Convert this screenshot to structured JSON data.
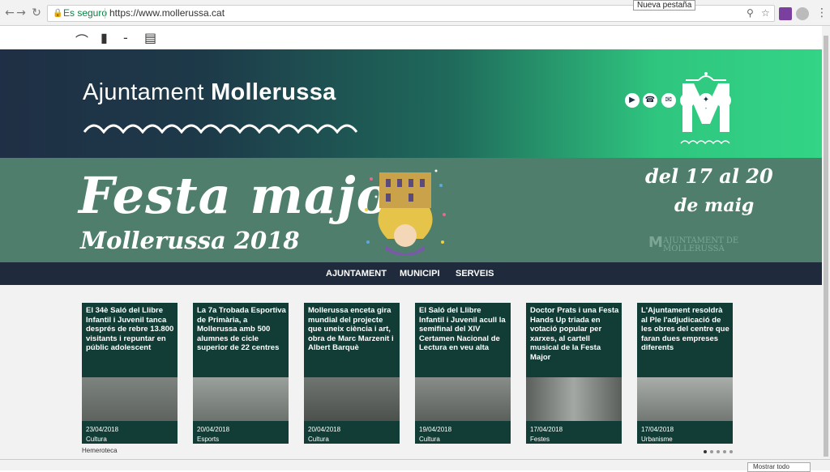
{
  "browser": {
    "secure_label": "Es seguro",
    "url": "https://www.mollerussa.cat",
    "tooltip": "Nueva pestaña",
    "icons": [
      "back-icon",
      "forward-icon",
      "reload-icon",
      "lock-icon",
      "search-icon",
      "star-icon",
      "menu-icon"
    ]
  },
  "accessibility": {
    "icons": [
      "contrast-icon",
      "text-size-icon",
      "minus-icon",
      "font-icon"
    ]
  },
  "header": {
    "title_light": "Ajuntament ",
    "title_bold": "Mollerussa",
    "logo_letter": "M",
    "social_icons": [
      "youtube-icon",
      "phone-icon",
      "email-icon",
      "facebook-icon",
      "twitter-icon",
      "instagram-icon"
    ],
    "colors": {
      "dark": "#1f2f45",
      "accent": "#33d486"
    }
  },
  "banner": {
    "title": "Festa major",
    "subtitle": "Mollerussa 2018",
    "dates_line1": "del 17 al 20",
    "dates_line2": "de maig",
    "logo_letter": "M",
    "logo_text": "AJUNTAMENT DE MOLLERUSSA"
  },
  "nav": {
    "items": [
      "AJUNTAMENT",
      "MUNICIPI",
      "SERVEIS"
    ]
  },
  "news": {
    "cards": [
      {
        "title": "El 34è Saló del Llibre Infantil i Juvenil tanca després de rebre 13.800 visitants i repuntar en públic adolescent",
        "date": "23/04/2018",
        "category": "Cultura"
      },
      {
        "title": "La 7a Trobada Esportiva de Primària, a Mollerussa amb 500 alumnes de cicle superior de 22 centres",
        "date": "20/04/2018",
        "category": "Esports"
      },
      {
        "title": "Mollerussa enceta gira mundial del projecte que uneix ciència i art, obra de Marc Marzenit i Albert Barquè",
        "date": "20/04/2018",
        "category": "Cultura"
      },
      {
        "title": "El Saló del Llibre Infantil i Juvenil acull la semifinal del XIV Certamen Nacional de Lectura en veu alta",
        "date": "19/04/2018",
        "category": "Cultura"
      },
      {
        "title": "Doctor Prats i una Festa Hands Up triada en votació popular per xarxes, al cartell musical de la Festa Major",
        "date": "17/04/2018",
        "category": "Festes"
      },
      {
        "title": "L'Ajuntament resoldrà al Ple l'adjudicació de les obres del centre que faran dues empreses diferents",
        "date": "17/04/2018",
        "category": "Urbanisme"
      }
    ],
    "hemeroteca_label": "Hemeroteca",
    "carousel_dots": 5,
    "active_dot": 0
  },
  "downloads": {
    "show_all_label": "Mostrar todo"
  }
}
